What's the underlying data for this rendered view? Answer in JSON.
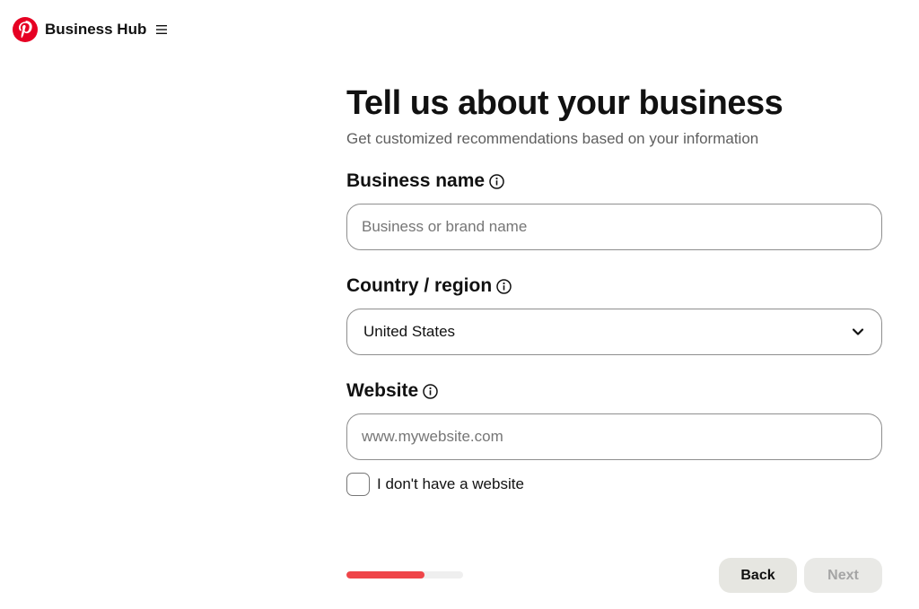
{
  "header": {
    "brand": "Business Hub",
    "logo_icon": "pinterest-logo-icon",
    "menu_icon": "hamburger-menu-icon",
    "brand_color": "#e60023"
  },
  "form": {
    "title": "Tell us about your business",
    "subtitle": "Get customized recommendations based on your information",
    "business_name": {
      "label": "Business name",
      "placeholder": "Business or brand name",
      "value": ""
    },
    "country": {
      "label": "Country / region",
      "value": "United States"
    },
    "website": {
      "label": "Website",
      "placeholder": "www.mywebsite.com",
      "value": ""
    },
    "no_website": {
      "label": "I don't have a website",
      "checked": false
    }
  },
  "footer": {
    "progress": 0.67,
    "progress_color": "#ef4549",
    "back_label": "Back",
    "next_label": "Next",
    "next_enabled": false
  }
}
